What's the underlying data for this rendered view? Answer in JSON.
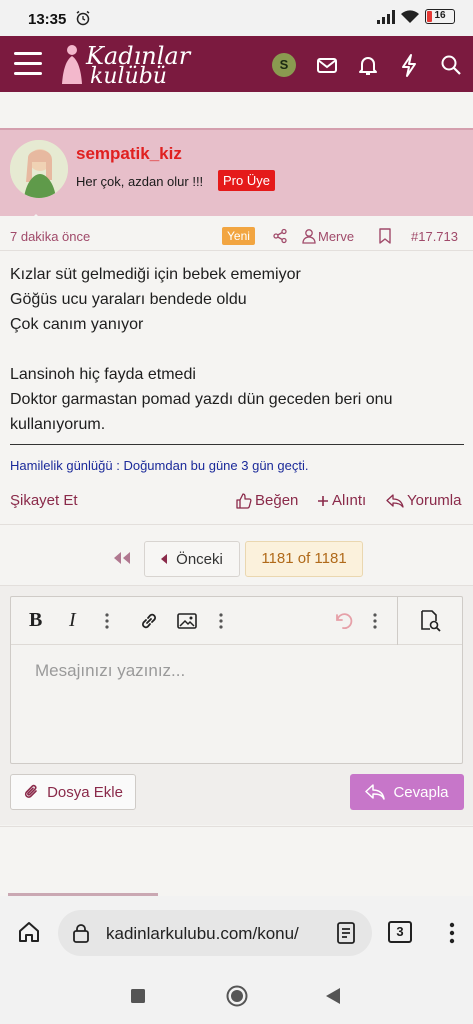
{
  "status_bar": {
    "time": "13:35",
    "battery": "16"
  },
  "header": {
    "logo_line1": "Kadınlar",
    "logo_line2": "kulübü",
    "user_initial": "S"
  },
  "post": {
    "username": "sempatik_kiz",
    "user_title": "Her çok, azdan olur !!!",
    "badge": "Pro Üye",
    "time_ago": "7 dakika önce",
    "new_label": "Yeni",
    "mentioned_user": "Merve",
    "post_number": "#17.713",
    "body": [
      "Kızlar süt gelmediği için bebek ememiyor",
      "Göğüs ucu yaraları bendede oldu",
      "Çok canım yanıyor",
      "",
      "Lansinoh hiç fayda etmedi",
      "Doktor garmastan pomad yazdı dün geceden beri onu kullanıyorum."
    ],
    "signature": "Hamilelik günlüğü : Doğumdan bu güne 3 gün geçti.",
    "actions": {
      "report": "Şikayet Et",
      "like": "Beğen",
      "quote": "Alıntı",
      "reply": "Yorumla"
    }
  },
  "pagination": {
    "prev_label": "Önceki",
    "page_info": "1181 of 1181"
  },
  "editor": {
    "placeholder": "Mesajınızı yazınız...",
    "attach_label": "Dosya Ekle",
    "submit_label": "Cevapla"
  },
  "browser": {
    "url": "kadinlarkulubu.com/konu/",
    "tab_count": "3"
  },
  "colors": {
    "brand": "#7b1a3f",
    "user_block": "#e7bfca",
    "submit": "#c776c9",
    "username": "#e02020"
  }
}
